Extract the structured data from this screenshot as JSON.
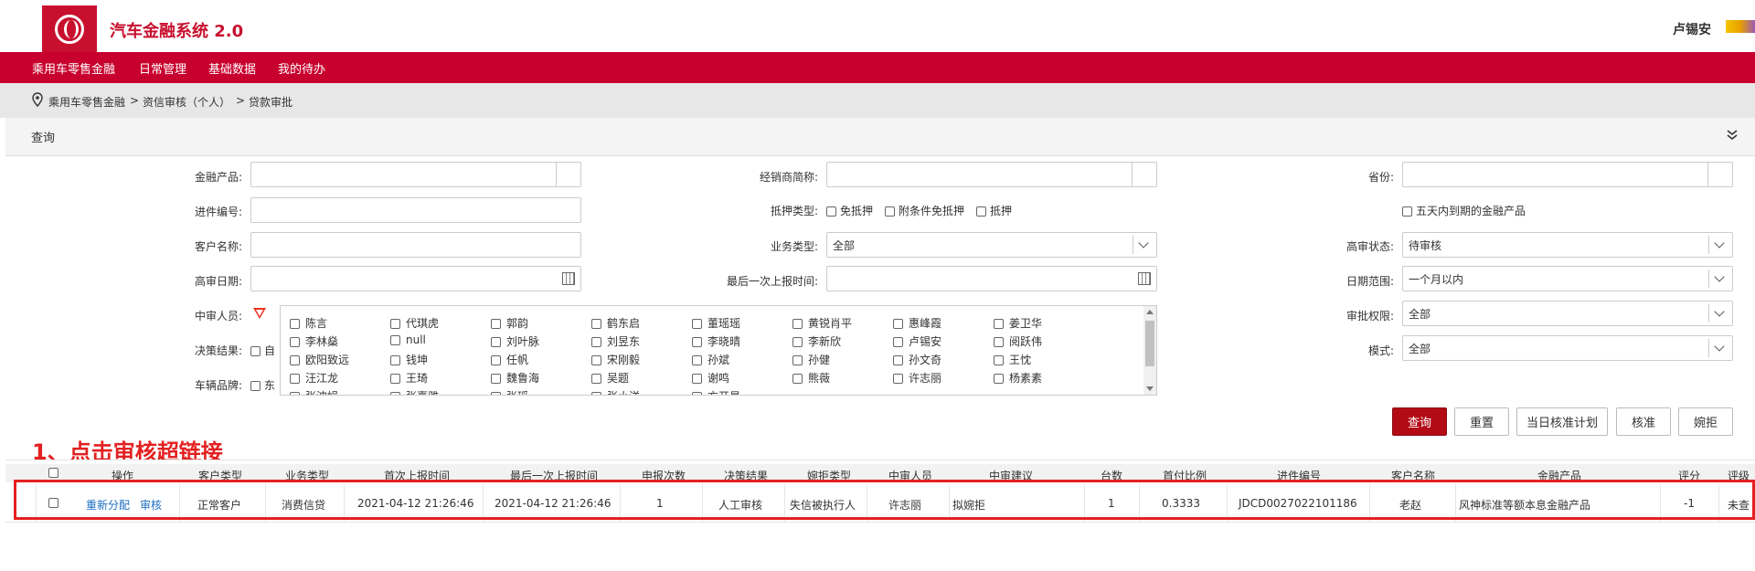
{
  "header": {
    "title": "汽车金融系统 2.0",
    "user": "卢锡安"
  },
  "nav": [
    "乘用车零售金融",
    "日常管理",
    "基础数据",
    "我的待办"
  ],
  "breadcrumb": [
    "乘用车零售金融",
    ">",
    "资信审核（个人）",
    ">",
    "贷款审批"
  ],
  "panel": {
    "title": "查询"
  },
  "filters": {
    "product_label": "金融产品:",
    "dealer_label": "经销商简称:",
    "province_label": "省份:",
    "order_label": "进件编号:",
    "mortgage_label": "抵押类型:",
    "mortgage_options": [
      "免抵押",
      "附条件免抵押",
      "抵押"
    ],
    "expiring_label": "五天内到期的金融产品",
    "customer_label": "客户名称:",
    "biz_type_label": "业务类型:",
    "biz_type_value": "全部",
    "review_status_label": "高审状态:",
    "review_status_value": "待审核",
    "review_date_label": "高审日期:",
    "last_report_label": "最后一次上报时间:",
    "date_range_label": "日期范围:",
    "date_range_value": "一个月以内",
    "mid_reviewer_label": "中审人员:",
    "approval_auth_label": "审批权限:",
    "approval_auth_value": "全部",
    "decision_label": "决策结果:",
    "decision_partial": "自",
    "mode_label": "模式:",
    "mode_value": "全部",
    "brand_label": "车辆品牌:",
    "brand_partial": "东"
  },
  "reviewers": [
    [
      "陈言",
      "代琪虎",
      "郭韵",
      "鹤东启",
      "董瑶瑶",
      "黄锐肖平",
      "惠峰霞",
      "姜卫华"
    ],
    [
      "李林燊",
      "null",
      "刘叶脉",
      "刘昱东",
      "李晓晴",
      "李新欣",
      "卢锡安",
      "阅跃伟"
    ],
    [
      "欧阳致远",
      "钱坤",
      "任帆",
      "宋刚毅",
      "孙斌",
      "孙健",
      "孙文奇",
      "王忱"
    ],
    [
      "汪江龙",
      "王琦",
      "魏鲁海",
      "吴题",
      "谢鸣",
      "熊薇",
      "许志丽",
      "杨素素"
    ],
    [
      "张波娟",
      "张嘉雅",
      "张瑶",
      "张小洋",
      "方开晨",
      "",
      "",
      ""
    ]
  ],
  "buttons": {
    "query": "查询",
    "reset": "重置",
    "daily_plan": "当日核准计划",
    "approve": "核准",
    "reject": "婉拒"
  },
  "annotation": "1、点击审核超链接",
  "table": {
    "headers": [
      "操作",
      "客户类型",
      "业务类型",
      "首次上报时间",
      "最后一次上报时间",
      "申报次数",
      "决策结果",
      "婉拒类型",
      "中审人员",
      "中审建议",
      "台数",
      "首付比例",
      "进件编号",
      "客户名称",
      "金融产品",
      "评分",
      "评级"
    ],
    "row": {
      "action_reassign": "重新分配",
      "action_review": "审核",
      "customer_type": "正常客户",
      "biz_type": "消费信贷",
      "first_report": "2021-04-12 21:26:46",
      "last_report": "2021-04-12 21:26:46",
      "report_count": "1",
      "decision": "人工审核",
      "reject_type": "失信被执行人",
      "mid_reviewer": "许志丽",
      "mid_advice": "拟婉拒",
      "units": "1",
      "down_payment": "0.3333",
      "order_no": "JDCD0027022101186",
      "customer_name": "老赵",
      "product": "风神标准等额本息金融产品",
      "score": "-1",
      "rating": "未查"
    }
  }
}
